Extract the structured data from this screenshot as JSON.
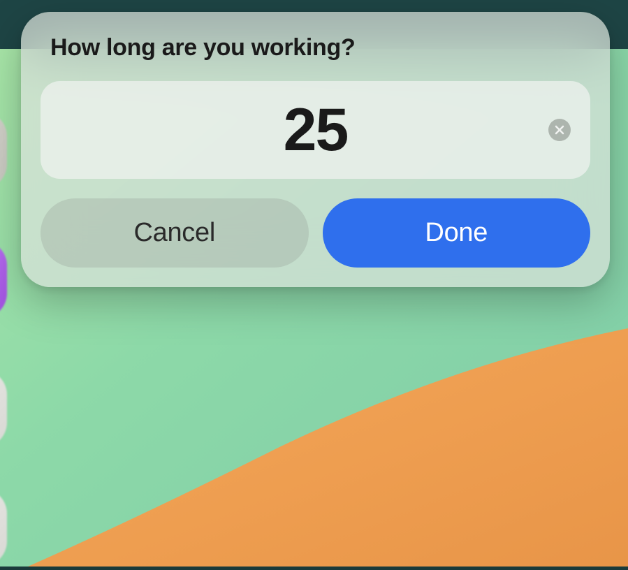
{
  "dialog": {
    "title": "How long are you working?",
    "duration_value": "25",
    "cancel_label": "Cancel",
    "done_label": "Done"
  },
  "icons": {
    "clear": "close-circle-icon"
  },
  "colors": {
    "done_button": "#2F6FED",
    "cancel_button_tint": "rgba(150,155,150,0.3)"
  }
}
